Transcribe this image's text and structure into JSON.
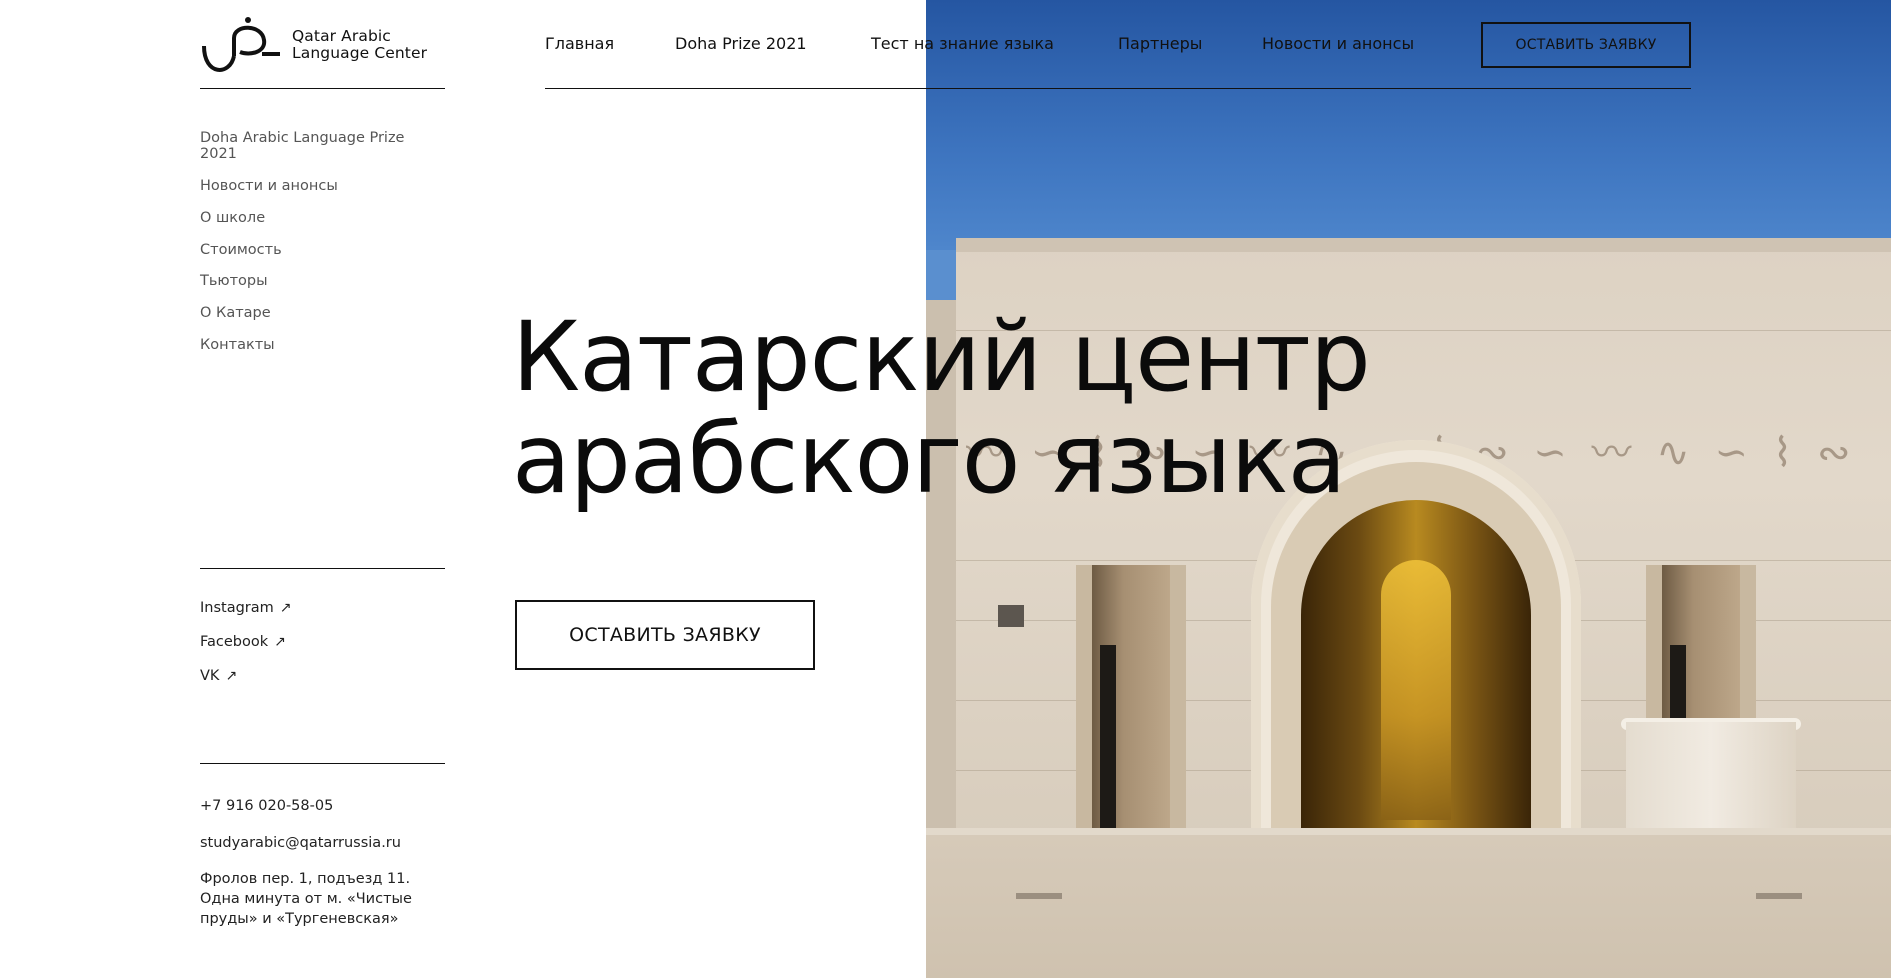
{
  "brand": {
    "line1": "Qatar Arabic",
    "line2": "Language Center",
    "logo_icon": "arabic-letter-dad-logo"
  },
  "top_nav": {
    "items": [
      {
        "label": "Главная"
      },
      {
        "label": "Doha Prize 2021"
      },
      {
        "label": "Тест на знание языка"
      },
      {
        "label": "Партнеры"
      },
      {
        "label": "Новости и анонсы"
      }
    ],
    "cta_label": "ОСТАВИТЬ ЗАЯВКУ"
  },
  "sidebar": {
    "menu": [
      {
        "label": "Doha Arabic Language Prize 2021"
      },
      {
        "label": "Новости и анонсы"
      },
      {
        "label": "О школе"
      },
      {
        "label": "Стоимость"
      },
      {
        "label": "Тьюторы"
      },
      {
        "label": "О Катаре"
      },
      {
        "label": "Контакты"
      }
    ],
    "socials": [
      {
        "label": "Instagram",
        "icon": "arrow-up-right-icon"
      },
      {
        "label": "Facebook",
        "icon": "arrow-up-right-icon"
      },
      {
        "label": "VK",
        "icon": "arrow-up-right-icon"
      }
    ],
    "contacts": {
      "phone": "+7 916 020-58-05",
      "email": "studyarabic@qatarrussia.ru",
      "address": "Фролов пер. 1, подъезд 11. Одна минута от м. «Чистые пруды» и «Тургеневская»"
    }
  },
  "hero": {
    "title_line1": "Катарский центр",
    "title_line2": "арабского языка",
    "cta_label": "ОСТАВИТЬ ЗАЯВКУ",
    "image_subject": "mosque-arch-facade-photo"
  },
  "colors": {
    "text": "#111111",
    "muted": "#555555",
    "sky": "#3d74bf",
    "stone": "#ddd2c3",
    "gold": "#c99624"
  }
}
